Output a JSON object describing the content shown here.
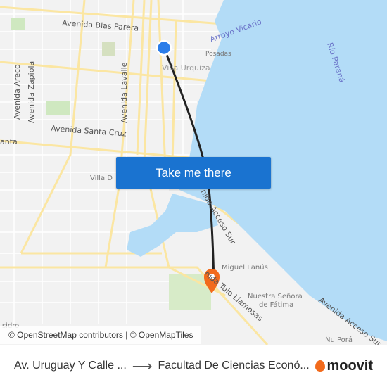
{
  "map": {
    "labels": {
      "blas_parera": "Avenida Blas Parera",
      "arroyo_vicario": "Arroyo Vicario",
      "posadas": "Posadas",
      "rio_parana": "Río Paraná",
      "villa_urquiza": "Villa Urquiza",
      "areco": "Avenida Areco",
      "zapiola": "Avenida Zapiola",
      "lavalle": "Avenida Lavalle",
      "santa_cruz": "Avenida Santa Cruz",
      "anta": "anta",
      "villa_d": "Villa D",
      "acceso_sur_1": "nida Acceso Sur",
      "acceso_sur_2": "Avenida Acceso Sur",
      "miguel_lanus": "Miguel Lanús",
      "nuestra_senora_1": "Nuestra Señora",
      "nuestra_senora_2": "de Fátima",
      "tulo_llamosas": "nida Tulo Llamosas",
      "isidro": "Isidro",
      "nu_pora": "Ñu Porá"
    },
    "colors": {
      "water": "#b3dcf7",
      "road": "#fbe6a2",
      "origin": "#2b7de9",
      "destination": "#f26a1b",
      "route": "#222222",
      "button": "#1a73d0"
    },
    "cta_label": "Take me there",
    "attribution": "© OpenStreetMap contributors | © OpenMapTiles"
  },
  "footer": {
    "from": "Av. Uruguay Y Calle ...",
    "to": "Facultad De Ciencias Econó...",
    "brand": "moovit"
  }
}
